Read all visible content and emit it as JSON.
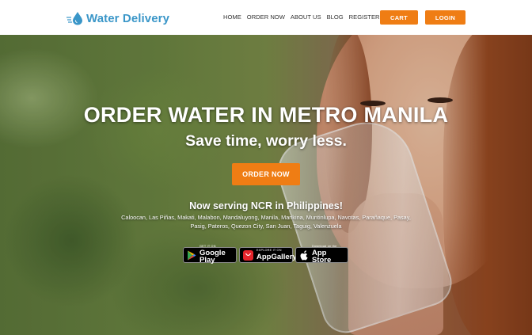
{
  "header": {
    "logo_text": "Water Delivery",
    "nav": [
      "HOME",
      "ORDER NOW",
      "ABOUT US",
      "BLOG",
      "REGISTER"
    ],
    "cart_label": "CART",
    "login_label": "LOGIN"
  },
  "hero": {
    "title": "ORDER WATER IN METRO MANILA",
    "subtitle": "Save time, worry less.",
    "order_button": "ORDER NOW",
    "serving": "Now serving NCR in Philippines!",
    "cities": "Caloocan, Las Piñas, Makati, Malabon, Mandaluyong, Manila, Marikina, Muntinlupa, Navotas, Parañaque, Pasay, Pasig, Pateros, Quezon City, San Juan, Taguig, Valenzuela",
    "stores": [
      {
        "small": "GET IT ON",
        "big": "Google Play",
        "icon": "google-play-icon"
      },
      {
        "small": "EXPLORE IT ON",
        "big": "AppGallery",
        "icon": "huawei-appgallery-icon"
      },
      {
        "small": "Download on the",
        "big": "App Store",
        "icon": "apple-icon"
      }
    ]
  },
  "colors": {
    "accent": "#ef7d14",
    "logo": "#3a96c8"
  }
}
